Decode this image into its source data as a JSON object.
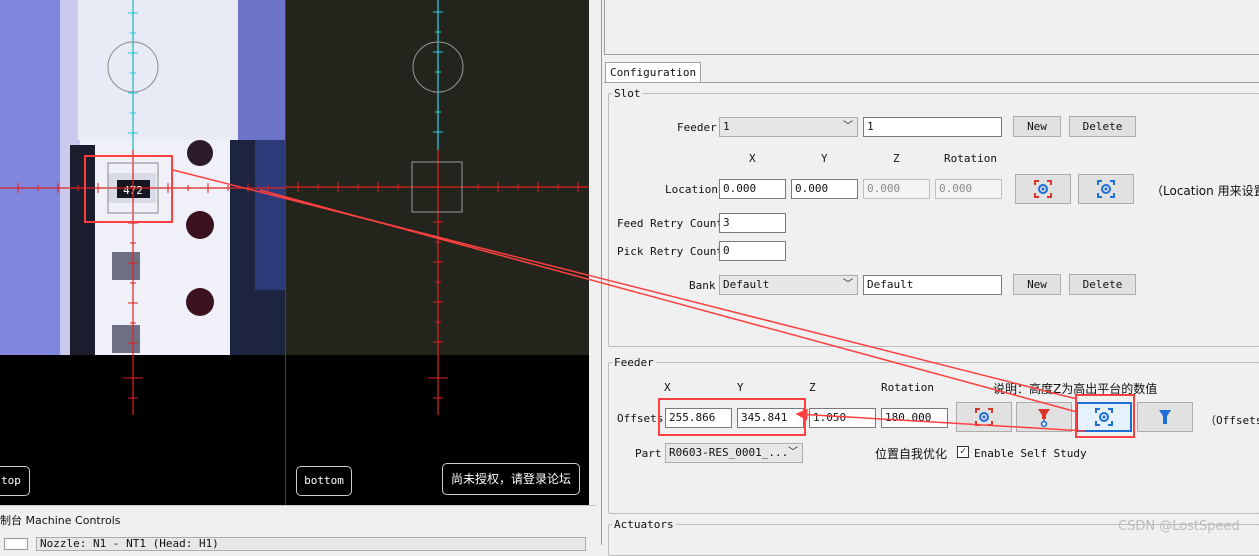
{
  "cameras": {
    "top": {
      "label": "top"
    },
    "bottom": {
      "label": "bottom",
      "notice": "尚未授权，请登录论坛"
    },
    "component_marking": "472"
  },
  "machine_controls": {
    "title": "制台 Machine Controls",
    "selector_value": "Nozzle: N1 - NT1 (Head: H1)"
  },
  "panel": {
    "tab": "Configuration",
    "slot": {
      "title": "Slot",
      "feeder_label": "Feeder",
      "feeder_select": "1",
      "feeder_name": "1",
      "new_label": "New",
      "delete_label": "Delete",
      "col_x": "X",
      "col_y": "Y",
      "col_z": "Z",
      "col_rotation": "Rotation",
      "location_label": "Location",
      "loc_x": "0.000",
      "loc_y": "0.000",
      "loc_z": "0.000",
      "loc_rot": "0.000",
      "location_note": "（Location 用来设置",
      "feed_retry_label": "Feed Retry Count",
      "feed_retry_value": "3",
      "pick_retry_label": "Pick Retry Count",
      "pick_retry_value": "0",
      "bank_label": "Bank",
      "bank_select": "Default",
      "bank_name": "Default",
      "bank_new_label": "New",
      "bank_delete_label": "Delete"
    },
    "feeder": {
      "title": "Feeder",
      "col_x": "X",
      "col_y": "Y",
      "col_z": "Z",
      "col_rotation": "Rotation",
      "note": "说明：高度Z为高出平台的数值",
      "offsets_label": "Offsets",
      "off_x": "255.866",
      "off_y": "345.841",
      "off_z": "1.050",
      "off_rot": "180.000",
      "offsets_note": "（Offsets",
      "part_label": "Part",
      "part_value": "R0603-RES_0001_...",
      "self_opt_label": "位置自我优化",
      "self_study_label": "Enable Self Study",
      "self_study_checked": true
    },
    "actuators": {
      "title": "Actuators"
    }
  },
  "watermark": "CSDN @LostSpeed",
  "colors": {
    "accent_red": "#ff4040",
    "icon_blue": "#1e6ed8",
    "icon_red": "#d9362b",
    "crosshair_red": "#e02020",
    "crosshair_cyan": "#20d0e0"
  }
}
